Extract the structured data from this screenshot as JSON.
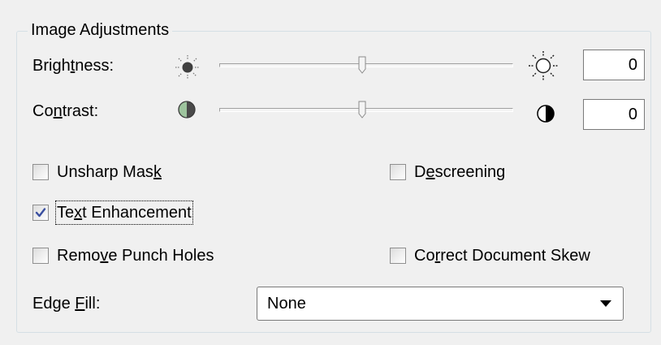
{
  "group": {
    "title": "Image Adjustments"
  },
  "brightness": {
    "label_pre": "Brigh",
    "label_u": "t",
    "label_post": "ness:",
    "value": "0",
    "level": 0.5,
    "low_icon": "sun-dim-icon",
    "high_icon": "sun-bright-icon"
  },
  "contrast": {
    "label_pre": "Co",
    "label_u": "n",
    "label_post": "trast:",
    "value": "0",
    "level": 0.5,
    "low_icon": "contrast-low-icon",
    "high_icon": "contrast-high-icon"
  },
  "options": {
    "unsharp": {
      "pre": "Unsharp Mas",
      "u": "k",
      "post": "",
      "checked": false
    },
    "descreening": {
      "pre": "D",
      "u": "e",
      "post": "screening",
      "checked": false
    },
    "text_enh": {
      "pre": "Te",
      "u": "x",
      "post": "t Enhancement",
      "checked": true
    },
    "punch": {
      "pre": "Remo",
      "u": "v",
      "post": "e Punch Holes",
      "checked": false
    },
    "skew": {
      "pre": "Co",
      "u": "r",
      "post": "rect Document Skew",
      "checked": false
    }
  },
  "edge_fill": {
    "label_pre": "Edge ",
    "label_u": "F",
    "label_post": "ill:",
    "selected": "None"
  },
  "colors": {
    "check": "#3a4fa0",
    "panel": "#f0f0f0",
    "groupbox_border": "#d5dfe5"
  }
}
